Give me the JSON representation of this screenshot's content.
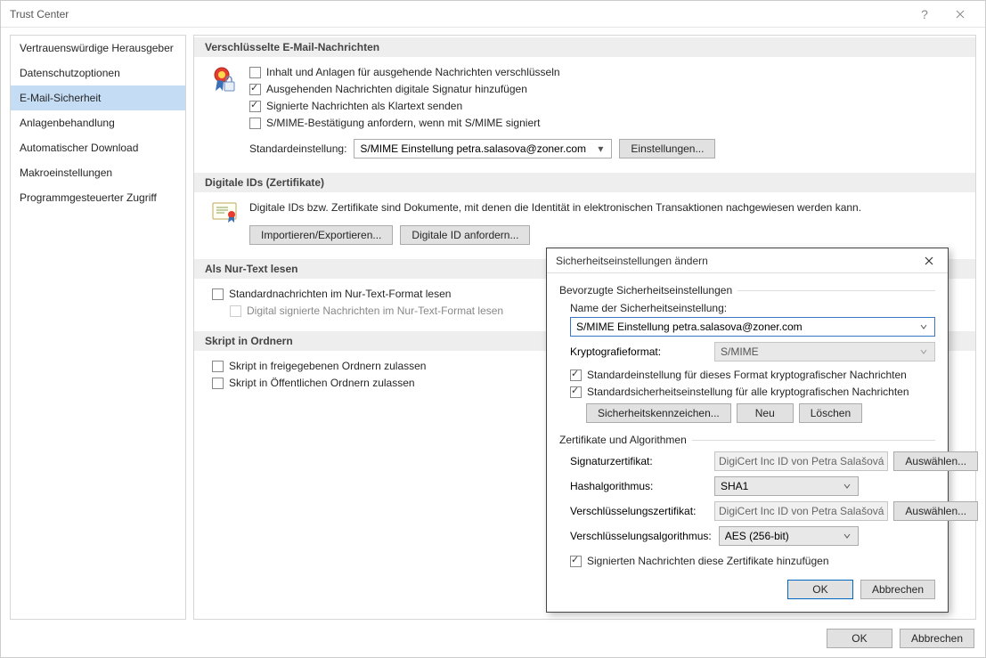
{
  "window": {
    "title": "Trust Center",
    "ok": "OK",
    "cancel": "Abbrechen"
  },
  "sidebar": {
    "items": [
      {
        "label": "Vertrauenswürdige Herausgeber"
      },
      {
        "label": "Datenschutzoptionen"
      },
      {
        "label": "E-Mail-Sicherheit"
      },
      {
        "label": "Anlagenbehandlung"
      },
      {
        "label": "Automatischer Download"
      },
      {
        "label": "Makroeinstellungen"
      },
      {
        "label": "Programmgesteuerter Zugriff"
      }
    ]
  },
  "sections": {
    "encrypted": {
      "header": "Verschlüsselte E-Mail-Nachrichten",
      "c1": "Inhalt und Anlagen für ausgehende Nachrichten verschlüsseln",
      "c2": "Ausgehenden Nachrichten digitale Signatur hinzufügen",
      "c3": "Signierte Nachrichten als Klartext senden",
      "c4": "S/MIME-Bestätigung anfordern, wenn mit S/MIME signiert",
      "default_label": "Standardeinstellung:",
      "default_value": "S/MIME Einstellung petra.salasova@zoner.com",
      "settings_btn": "Einstellungen..."
    },
    "certs": {
      "header": "Digitale IDs (Zertifikate)",
      "desc": "Digitale IDs bzw. Zertifikate sind Dokumente, mit denen die Identität in elektronischen Transaktionen nachgewiesen werden kann.",
      "import_btn": "Importieren/Exportieren...",
      "request_btn": "Digitale ID anfordern..."
    },
    "plaintext": {
      "header": "Als Nur-Text lesen",
      "c1": "Standardnachrichten im Nur-Text-Format lesen",
      "c2": "Digital signierte Nachrichten im Nur-Text-Format lesen"
    },
    "scripts": {
      "header": "Skript in Ordnern",
      "c1": "Skript in freigegebenen Ordnern zulassen",
      "c2": "Skript in Öffentlichen Ordnern zulassen"
    }
  },
  "modal": {
    "title": "Sicherheitseinstellungen ändern",
    "group1": "Bevorzugte Sicherheitseinstellungen",
    "name_label": "Name der Sicherheitseinstellung:",
    "name_value": "S/MIME Einstellung petra.salasova@zoner.com",
    "crypto_label": "Kryptografieformat:",
    "crypto_value": "S/MIME",
    "c1": "Standardeinstellung für dieses Format kryptografischer Nachrichten",
    "c2": "Standardsicherheitseinstellung für alle kryptografischen Nachrichten",
    "btn_tags": "Sicherheitskennzeichen...",
    "btn_new": "Neu",
    "btn_delete": "Löschen",
    "group2": "Zertifikate und Algorithmen",
    "sig_cert_label": "Signaturzertifikat:",
    "sig_cert_value": "DigiCert Inc ID von Petra Salašová",
    "select_btn": "Auswählen...",
    "hash_label": "Hashalgorithmus:",
    "hash_value": "SHA1",
    "enc_cert_label": "Verschlüsselungszertifikat:",
    "enc_cert_value": "DigiCert Inc ID von Petra Salašová",
    "enc_algo_label": "Verschlüsselungsalgorithmus:",
    "enc_algo_value": "AES (256-bit)",
    "c3": "Signierten Nachrichten diese Zertifikate hinzufügen",
    "ok": "OK",
    "cancel": "Abbrechen"
  }
}
